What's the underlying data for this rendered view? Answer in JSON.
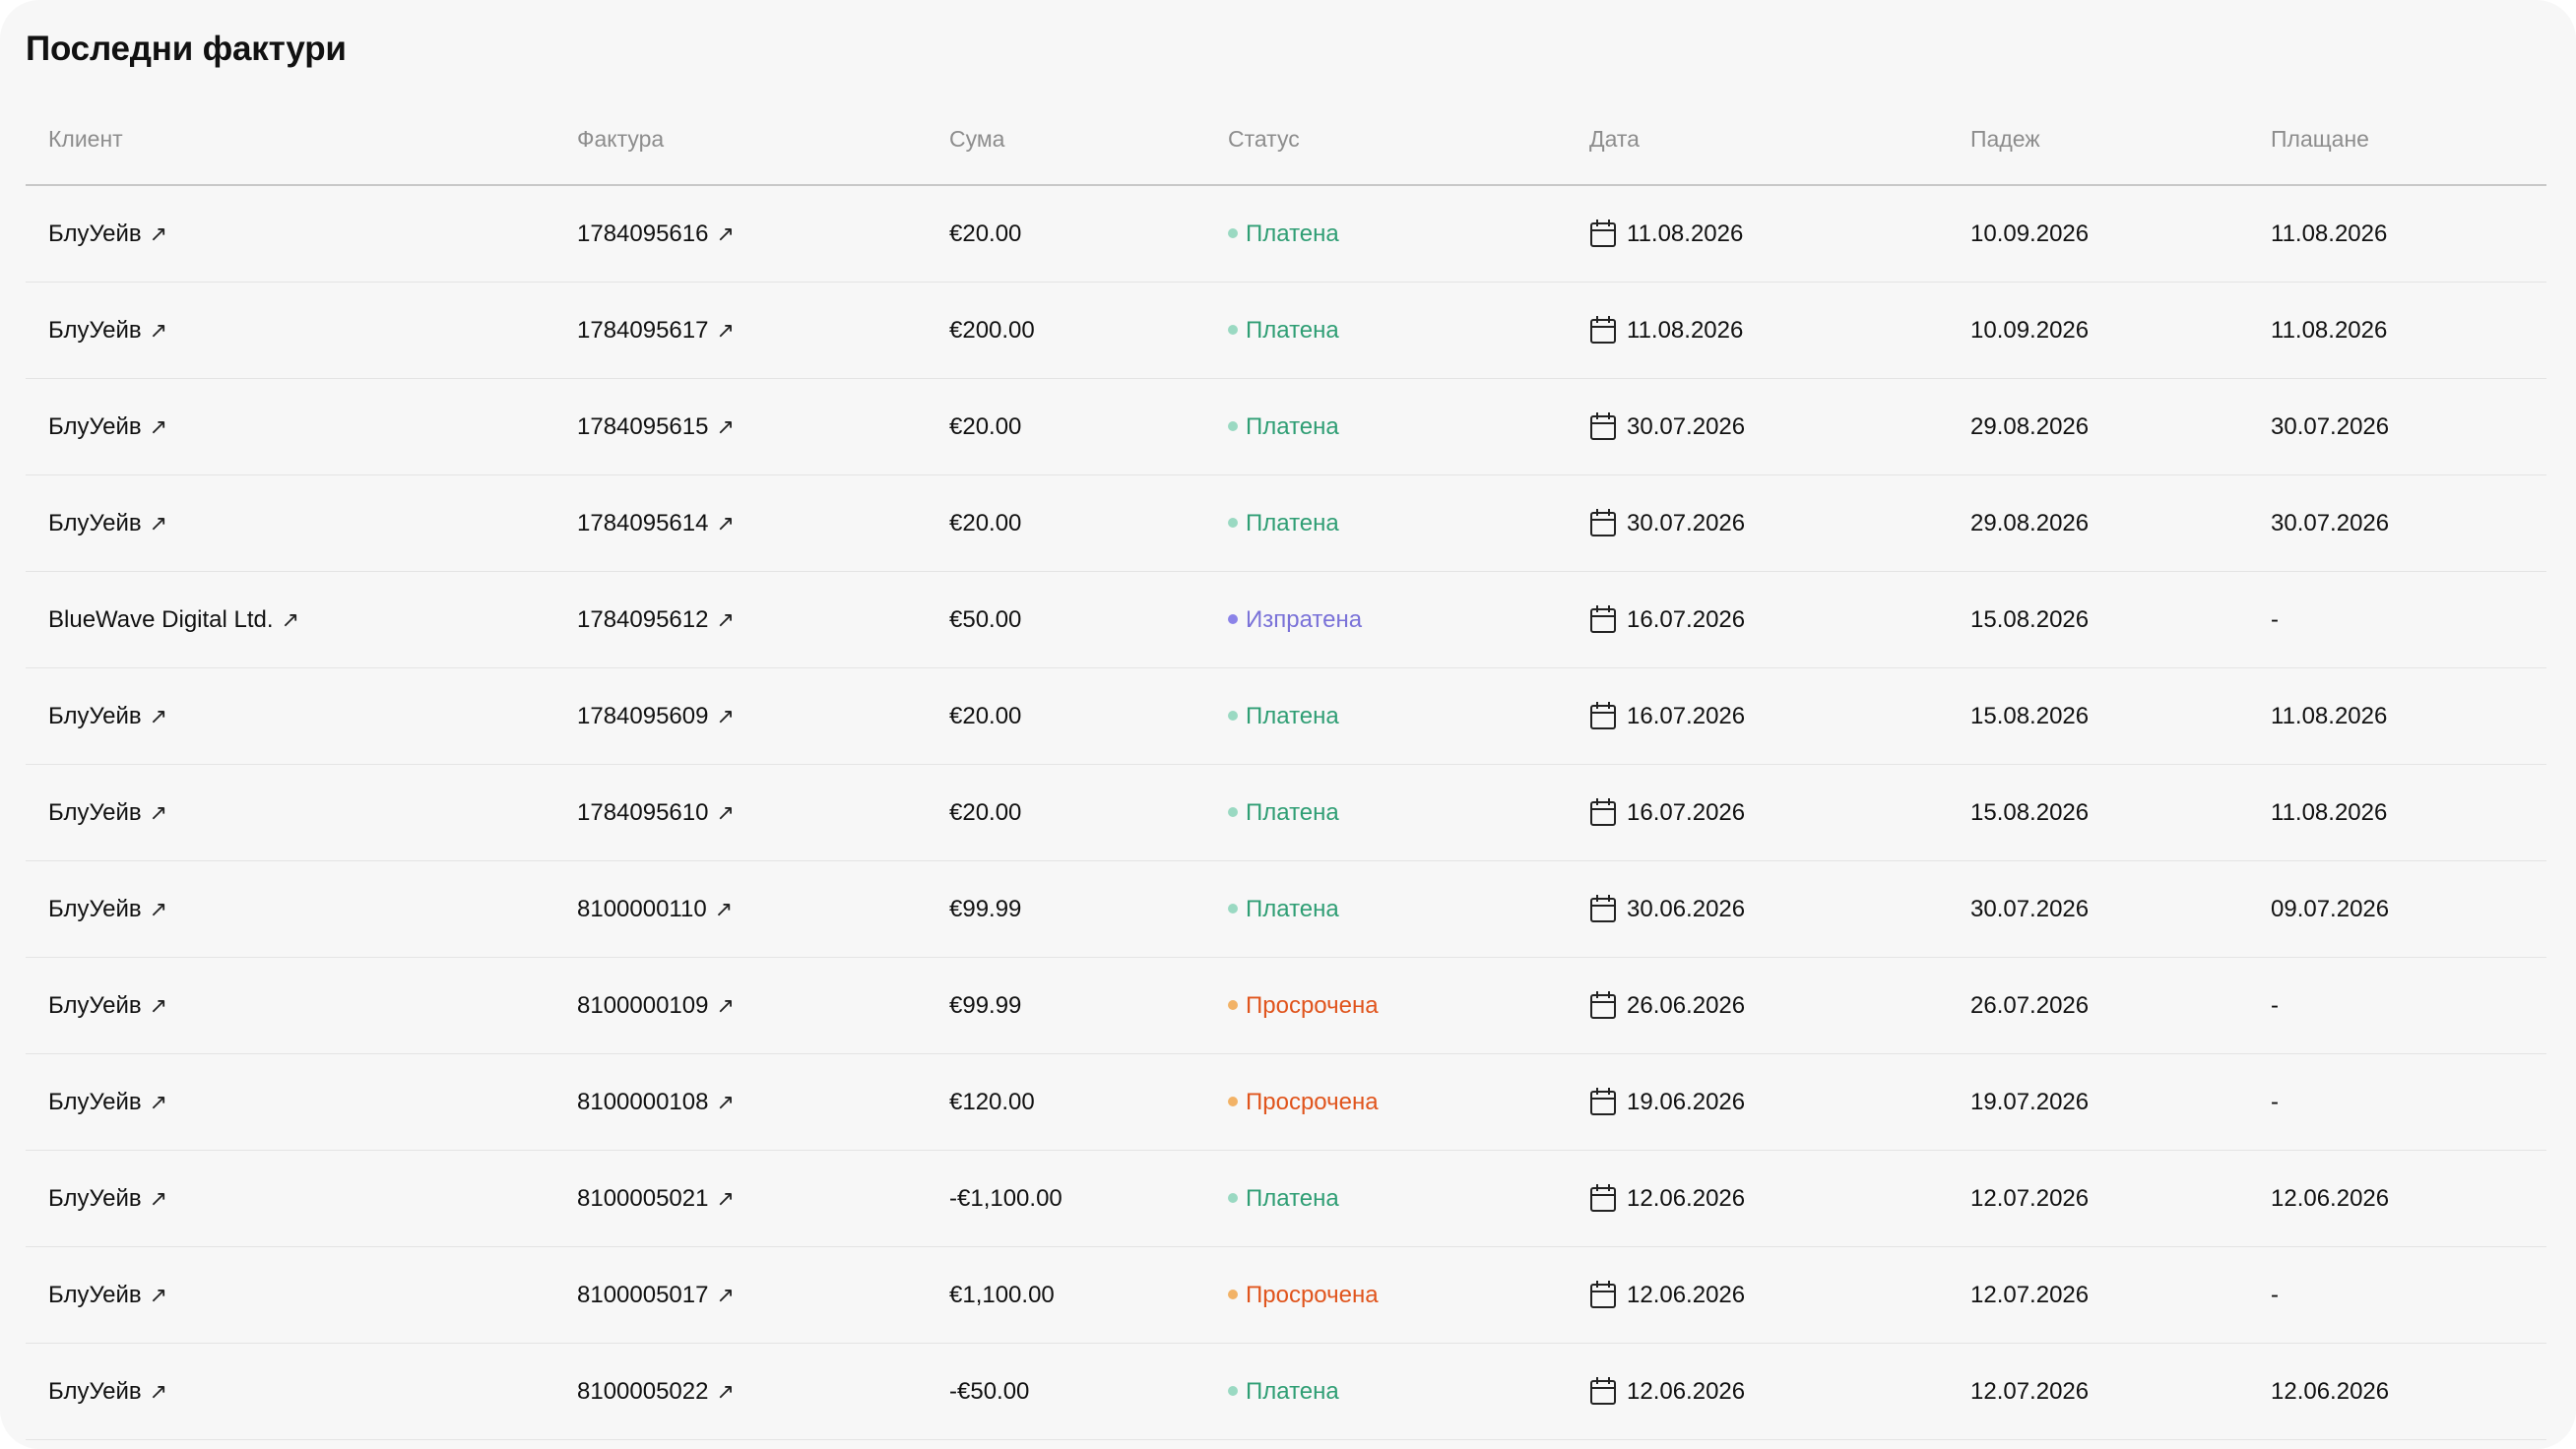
{
  "title": "Последни фактури",
  "columns": {
    "client": "Клиент",
    "invoice": "Фактура",
    "amount": "Сума",
    "status": "Статус",
    "date": "Дата",
    "due": "Падеж",
    "payment": "Плащане"
  },
  "status_colors": {
    "Платена": {
      "dot": "#9ad9c2",
      "text": "#2f9e74"
    },
    "Изпратена": {
      "dot": "#8b83e8",
      "text": "#7a72d8"
    },
    "Просрочена": {
      "dot": "#f2b266",
      "text": "#e0541c"
    }
  },
  "rows": [
    {
      "client": "БлуУейв",
      "invoice": "1784095616",
      "amount": "€20.00",
      "status": "Платена",
      "date": "11.08.2026",
      "due": "10.09.2026",
      "payment": "11.08.2026"
    },
    {
      "client": "БлуУейв",
      "invoice": "1784095617",
      "amount": "€200.00",
      "status": "Платена",
      "date": "11.08.2026",
      "due": "10.09.2026",
      "payment": "11.08.2026"
    },
    {
      "client": "БлуУейв",
      "invoice": "1784095615",
      "amount": "€20.00",
      "status": "Платена",
      "date": "30.07.2026",
      "due": "29.08.2026",
      "payment": "30.07.2026"
    },
    {
      "client": "БлуУейв",
      "invoice": "1784095614",
      "amount": "€20.00",
      "status": "Платена",
      "date": "30.07.2026",
      "due": "29.08.2026",
      "payment": "30.07.2026"
    },
    {
      "client": "BlueWave Digital Ltd.",
      "invoice": "1784095612",
      "amount": "€50.00",
      "status": "Изпратена",
      "date": "16.07.2026",
      "due": "15.08.2026",
      "payment": "-"
    },
    {
      "client": "БлуУейв",
      "invoice": "1784095609",
      "amount": "€20.00",
      "status": "Платена",
      "date": "16.07.2026",
      "due": "15.08.2026",
      "payment": "11.08.2026"
    },
    {
      "client": "БлуУейв",
      "invoice": "1784095610",
      "amount": "€20.00",
      "status": "Платена",
      "date": "16.07.2026",
      "due": "15.08.2026",
      "payment": "11.08.2026"
    },
    {
      "client": "БлуУейв",
      "invoice": "8100000110",
      "amount": "€99.99",
      "status": "Платена",
      "date": "30.06.2026",
      "due": "30.07.2026",
      "payment": "09.07.2026"
    },
    {
      "client": "БлуУейв",
      "invoice": "8100000109",
      "amount": "€99.99",
      "status": "Просрочена",
      "date": "26.06.2026",
      "due": "26.07.2026",
      "payment": "-"
    },
    {
      "client": "БлуУейв",
      "invoice": "8100000108",
      "amount": "€120.00",
      "status": "Просрочена",
      "date": "19.06.2026",
      "due": "19.07.2026",
      "payment": "-"
    },
    {
      "client": "БлуУейв",
      "invoice": "8100005021",
      "amount": "-€1,100.00",
      "status": "Платена",
      "date": "12.06.2026",
      "due": "12.07.2026",
      "payment": "12.06.2026"
    },
    {
      "client": "БлуУейв",
      "invoice": "8100005017",
      "amount": "€1,100.00",
      "status": "Просрочена",
      "date": "12.06.2026",
      "due": "12.07.2026",
      "payment": "-"
    },
    {
      "client": "БлуУейв",
      "invoice": "8100005022",
      "amount": "-€50.00",
      "status": "Платена",
      "date": "12.06.2026",
      "due": "12.07.2026",
      "payment": "12.06.2026"
    }
  ]
}
